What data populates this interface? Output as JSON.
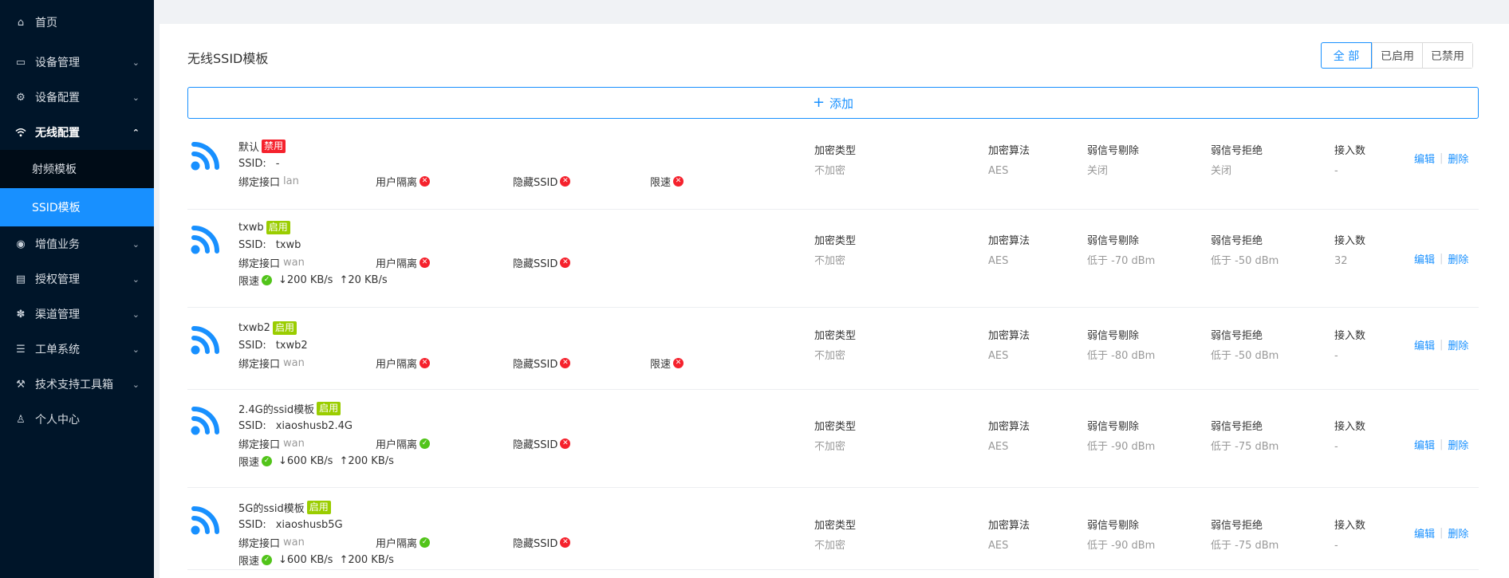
{
  "sidebar": {
    "items": [
      {
        "label": "首页",
        "icon": "home-icon"
      },
      {
        "label": "设备管理",
        "icon": "monitor-icon"
      },
      {
        "label": "设备配置",
        "icon": "gear-icon"
      },
      {
        "label": "无线配置",
        "icon": "wifi-icon"
      },
      {
        "label": "增值业务",
        "icon": "coin-icon"
      },
      {
        "label": "授权管理",
        "icon": "license-icon"
      },
      {
        "label": "渠道管理",
        "icon": "channel-icon"
      },
      {
        "label": "工单系统",
        "icon": "ticket-icon"
      },
      {
        "label": "技术支持工具箱",
        "icon": "wrench-icon"
      },
      {
        "label": "个人中心",
        "icon": "user-icon"
      }
    ],
    "submenu": [
      "射频模板",
      "SSID模板"
    ]
  },
  "page": {
    "title": "无线SSID模板",
    "filters": [
      "全 部",
      "已启用",
      "已禁用"
    ],
    "add_label": "添加"
  },
  "labels": {
    "ssid": "SSID:",
    "bind": "绑定接口",
    "isolation": "用户隔离",
    "hidden": "隐藏SSID",
    "limit": "限速",
    "enc_type": "加密类型",
    "enc_alg": "加密算法",
    "weak_kick": "弱信号剔除",
    "weak_reject": "弱信号拒绝",
    "clients": "接入数",
    "edit": "编辑",
    "delete": "删除",
    "enabled": "启用",
    "disabled": "禁用"
  },
  "colors": {
    "accent": "#1890ff",
    "sidebar": "#001529",
    "enabled_badge": "#9acd00",
    "disabled_badge": "#f5222d",
    "ok": "#52c41a",
    "no": "#f5222d"
  },
  "templates": [
    {
      "name": "默认",
      "status": "禁用",
      "ssid": "-",
      "iface": "lan",
      "isolation": false,
      "hidden": false,
      "limit": false,
      "down": "",
      "up": "",
      "enc_type": "不加密",
      "enc_alg": "AES",
      "weak_kick": "关闭",
      "weak_reject": "关闭",
      "clients": "-"
    },
    {
      "name": "txwb",
      "status": "启用",
      "ssid": "txwb",
      "iface": "wan",
      "isolation": false,
      "hidden": false,
      "limit": true,
      "down": "↓200 KB/s",
      "up": "↑20 KB/s",
      "enc_type": "不加密",
      "enc_alg": "AES",
      "weak_kick": "低于 -70 dBm",
      "weak_reject": "低于 -50 dBm",
      "clients": "32"
    },
    {
      "name": "txwb2",
      "status": "启用",
      "ssid": "txwb2",
      "iface": "wan",
      "isolation": false,
      "hidden": false,
      "limit": false,
      "down": "",
      "up": "",
      "enc_type": "不加密",
      "enc_alg": "AES",
      "weak_kick": "低于 -80 dBm",
      "weak_reject": "低于 -50 dBm",
      "clients": "-"
    },
    {
      "name": "2.4G的ssid模板",
      "status": "启用",
      "ssid": "xiaoshusb2.4G",
      "iface": "wan",
      "isolation": true,
      "hidden": false,
      "limit": true,
      "down": "↓600 KB/s",
      "up": "↑200 KB/s",
      "enc_type": "不加密",
      "enc_alg": "AES",
      "weak_kick": "低于 -90 dBm",
      "weak_reject": "低于 -75 dBm",
      "clients": "-"
    },
    {
      "name": "5G的ssid模板",
      "status": "启用",
      "ssid": "xiaoshusb5G",
      "iface": "wan",
      "isolation": true,
      "hidden": false,
      "limit": true,
      "down": "↓600 KB/s",
      "up": "↑200 KB/s",
      "enc_type": "不加密",
      "enc_alg": "AES",
      "weak_kick": "低于 -90 dBm",
      "weak_reject": "低于 -75 dBm",
      "clients": "-"
    }
  ]
}
